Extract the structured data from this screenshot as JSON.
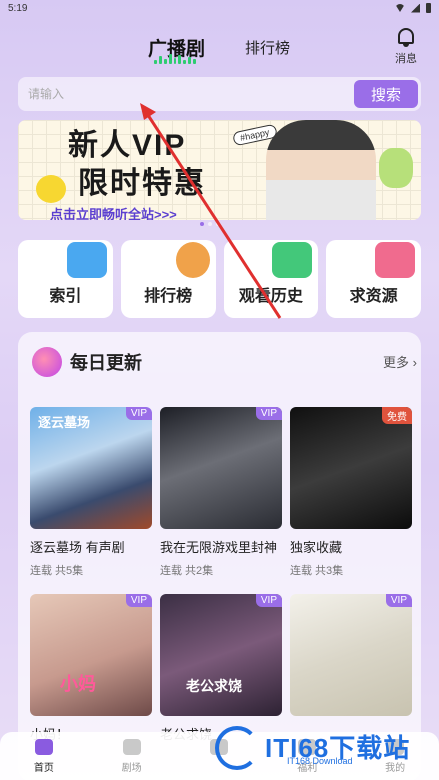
{
  "status": {
    "time": "5:19"
  },
  "nav": {
    "main_tab": "广播剧",
    "rank_tab": "排行榜",
    "message_label": "消息"
  },
  "search": {
    "placeholder": "请输入",
    "button": "搜索"
  },
  "banner": {
    "title": "新人VIP",
    "subtitle": "限时特惠",
    "link": "点击立即畅听全站>>>",
    "tag": "#happy"
  },
  "quick": [
    {
      "label": "索引"
    },
    {
      "label": "排行榜"
    },
    {
      "label": "观看历史"
    },
    {
      "label": "求资源"
    }
  ],
  "daily": {
    "title": "每日更新",
    "more": "更多",
    "items": [
      {
        "title": "逐云墓场 有声剧",
        "sub": "连载 共5集",
        "badge": "VIP",
        "cover_text": "逐云墓场"
      },
      {
        "title": "我在无限游戏里封神",
        "sub": "连载 共2集",
        "badge": "VIP",
        "cover_text": ""
      },
      {
        "title": "独家收藏",
        "sub": "连载 共3集",
        "badge": "免费",
        "cover_text": ""
      },
      {
        "title": "小妈！",
        "sub": "",
        "badge": "VIP",
        "cover_text": "小妈"
      },
      {
        "title": "老公求饶",
        "sub": "",
        "badge": "VIP",
        "cover_text": "老公求饶"
      },
      {
        "title": "",
        "sub": "",
        "badge": "VIP",
        "cover_text": ""
      }
    ]
  },
  "tabbar": [
    {
      "label": "首页"
    },
    {
      "label": "剧场"
    },
    {
      "label": ""
    },
    {
      "label": "福利"
    },
    {
      "label": "我的"
    }
  ],
  "watermark": {
    "main": "ITI68下载站",
    "sub": "IT168 Download"
  },
  "colors": {
    "accent": "#9a6ee8",
    "free_badge": "#e0533d"
  }
}
